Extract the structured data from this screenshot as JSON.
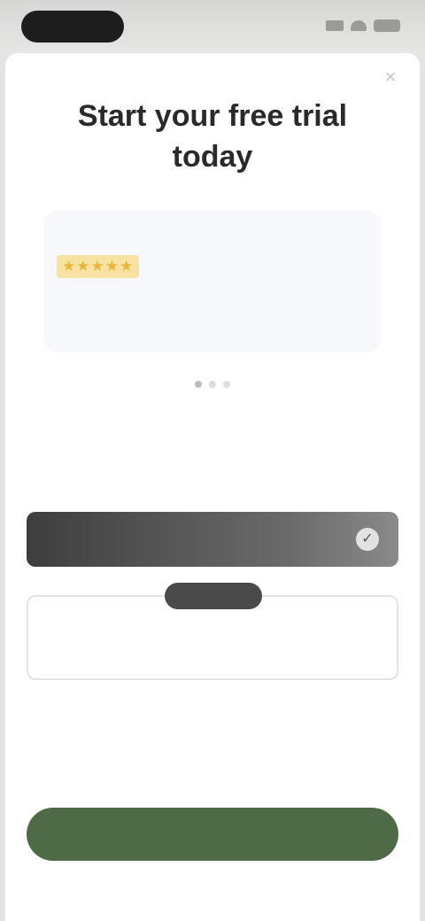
{
  "status_bar": {
    "time": ""
  },
  "header": {
    "close_icon": "×",
    "title": "Start your free trial today",
    "subtitle": ""
  },
  "review": {
    "reviewer": "",
    "stars": "★★★★★",
    "text": ""
  },
  "pager": {
    "pages": 3,
    "active": 0
  },
  "plans": {
    "yearly": {
      "label": "",
      "check": "✓"
    },
    "monthly": {
      "badge": "",
      "name": "",
      "price": "",
      "trial": ""
    }
  },
  "links": {
    "restore": "",
    "terms": ""
  },
  "notice": "",
  "cta": {
    "label": ""
  },
  "fine_print": "",
  "colors": {
    "accent_green": "#4f6b45",
    "plan_dark": "#3e3e3e",
    "star_bg": "#f7e2a3"
  }
}
